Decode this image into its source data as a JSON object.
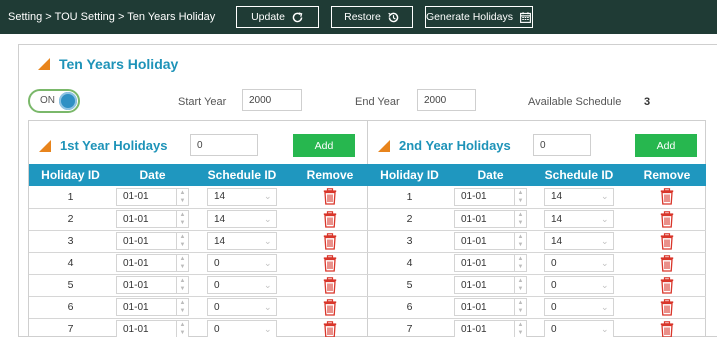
{
  "breadcrumb": "Setting > TOU Setting > Ten Years Holiday",
  "toolbar": {
    "update_label": "Update",
    "restore_label": "Restore",
    "generate_label": "Generate Holidays"
  },
  "section": {
    "title": "Ten Years Holiday",
    "toggle_label": "ON",
    "toggle_on": true,
    "start_year_label": "Start Year",
    "start_year_value": "2000",
    "end_year_label": "End Year",
    "end_year_value": "2000",
    "available_label": "Available Schedule",
    "available_value": "3"
  },
  "years": [
    {
      "title": "1st Year Holidays",
      "count_value": "0",
      "add_label": "Add",
      "columns": [
        "Holiday ID",
        "Date",
        "Schedule ID",
        "Remove"
      ],
      "rows": [
        {
          "id": "1",
          "date": "01-01",
          "schedule": "14"
        },
        {
          "id": "2",
          "date": "01-01",
          "schedule": "14"
        },
        {
          "id": "3",
          "date": "01-01",
          "schedule": "14"
        },
        {
          "id": "4",
          "date": "01-01",
          "schedule": "0"
        },
        {
          "id": "5",
          "date": "01-01",
          "schedule": "0"
        },
        {
          "id": "6",
          "date": "01-01",
          "schedule": "0"
        },
        {
          "id": "7",
          "date": "01-01",
          "schedule": "0"
        }
      ]
    },
    {
      "title": "2nd Year Holidays",
      "count_value": "0",
      "add_label": "Add",
      "columns": [
        "Holiday ID",
        "Date",
        "Schedule ID",
        "Remove"
      ],
      "rows": [
        {
          "id": "1",
          "date": "01-01",
          "schedule": "14"
        },
        {
          "id": "2",
          "date": "01-01",
          "schedule": "14"
        },
        {
          "id": "3",
          "date": "01-01",
          "schedule": "14"
        },
        {
          "id": "4",
          "date": "01-01",
          "schedule": "0"
        },
        {
          "id": "5",
          "date": "01-01",
          "schedule": "0"
        },
        {
          "id": "6",
          "date": "01-01",
          "schedule": "0"
        },
        {
          "id": "7",
          "date": "01-01",
          "schedule": "0"
        }
      ]
    }
  ],
  "colors": {
    "topbar": "#1f3b35",
    "accent_title": "#1e93b8",
    "table_header": "#1f97bf",
    "add_button": "#27b74f",
    "trash_icon": "#d9362b",
    "section_marker": "#e8841c"
  }
}
